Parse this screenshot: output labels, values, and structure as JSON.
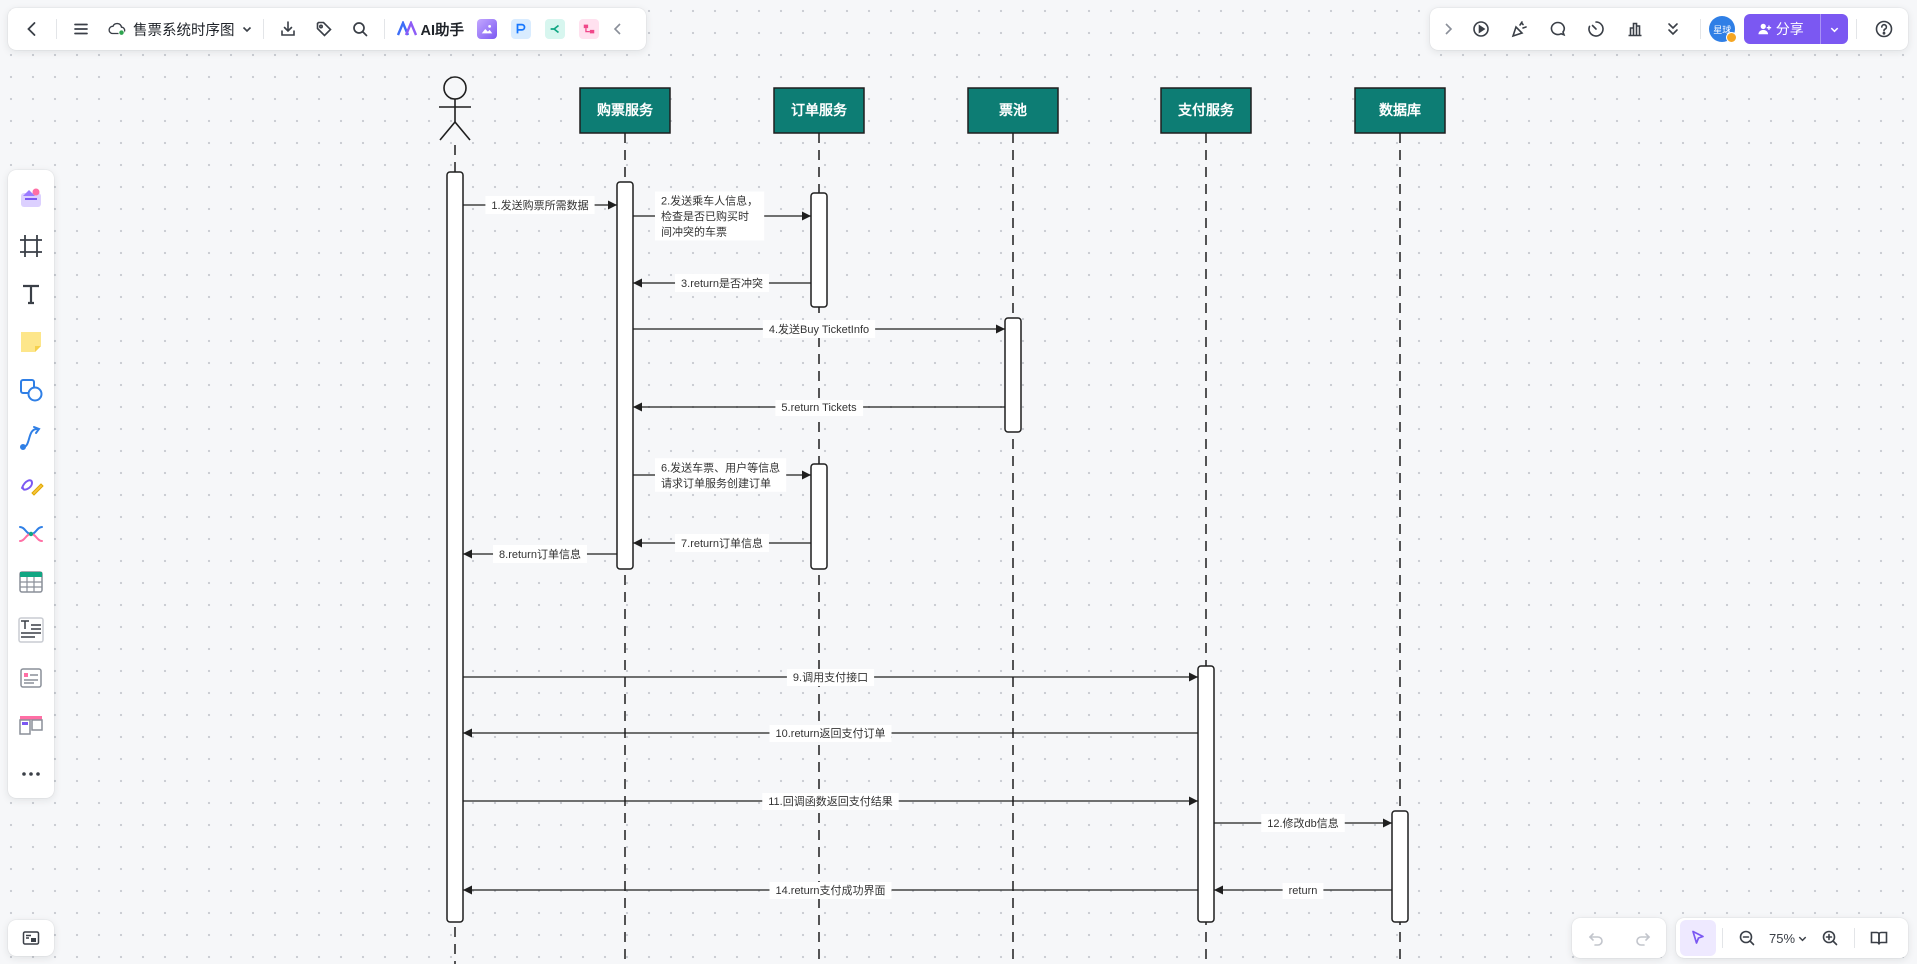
{
  "toolbar": {
    "doc_title": "售票系统时序图",
    "ai_label": "AI助手",
    "share_label": "分享",
    "avatar_label": "星球"
  },
  "view": {
    "zoom": "75%"
  },
  "diagram": {
    "actor": {
      "name": ""
    },
    "participants": [
      "购票服务",
      "订单服务",
      "票池",
      "支付服务",
      "数据库"
    ],
    "messages": [
      {
        "label": "1.发送购票所需数据",
        "from": "actor",
        "to": "购票服务",
        "type": "sync"
      },
      {
        "label": "2.发送乘车人信息，\n检查是否已购买时\n间冲突的车票",
        "from": "购票服务",
        "to": "订单服务",
        "type": "sync"
      },
      {
        "label": "3.return是否冲突",
        "from": "订单服务",
        "to": "购票服务",
        "type": "return"
      },
      {
        "label": "4.发送Buy TicketInfo",
        "from": "购票服务",
        "to": "票池",
        "type": "sync"
      },
      {
        "label": "5.return Tickets",
        "from": "票池",
        "to": "购票服务",
        "type": "return"
      },
      {
        "label": "6.发送车票、用户等信息\n请求订单服务创建订单",
        "from": "购票服务",
        "to": "订单服务",
        "type": "sync"
      },
      {
        "label": "7.return订单信息",
        "from": "订单服务",
        "to": "购票服务",
        "type": "return"
      },
      {
        "label": "8.return订单信息",
        "from": "购票服务",
        "to": "actor",
        "type": "return"
      },
      {
        "label": "9.调用支付接口",
        "from": "actor",
        "to": "支付服务",
        "type": "sync"
      },
      {
        "label": "10.return返回支付订单",
        "from": "支付服务",
        "to": "actor",
        "type": "return"
      },
      {
        "label": "11.回调函数返回支付结果",
        "from": "actor",
        "to": "支付服务",
        "type": "sync"
      },
      {
        "label": "12.修改db信息",
        "from": "支付服务",
        "to": "数据库",
        "type": "sync"
      },
      {
        "label": "return",
        "from": "数据库",
        "to": "支付服务",
        "type": "return"
      },
      {
        "label": "14.return支付成功界面",
        "from": "支付服务",
        "to": "actor",
        "type": "return"
      }
    ]
  },
  "colors": {
    "participant_fill": "#0d7d74",
    "accent": "#7b58f2",
    "line": "#1f1f1f"
  },
  "icons": {
    "top_left": [
      "back-icon",
      "menu-icon",
      "cloud-icon",
      "chevron-down-icon",
      "download-icon",
      "tag-icon",
      "search-icon",
      "ai-icon",
      "image-app-icon",
      "p-app-icon",
      "mindmap-app-icon",
      "flow-app-icon",
      "collapse-icon"
    ],
    "top_right": [
      "expand-icon",
      "play-icon",
      "celebrate-icon",
      "comment-icon",
      "timer-icon",
      "vote-icon",
      "more-icon",
      "user-plus-icon",
      "help-icon"
    ],
    "left_tools": [
      "template-icon",
      "frame-icon",
      "text-icon",
      "sticky-note-icon",
      "shape-icon",
      "connector-icon",
      "pen-icon",
      "mindmap-icon",
      "table-icon",
      "text-card-icon",
      "card-icon",
      "kanban-icon",
      "more-tools-icon"
    ],
    "bottom": [
      "minimap-icon",
      "undo-icon",
      "redo-icon",
      "select-icon",
      "zoom-out-icon",
      "zoom-in-icon",
      "book-icon"
    ]
  }
}
